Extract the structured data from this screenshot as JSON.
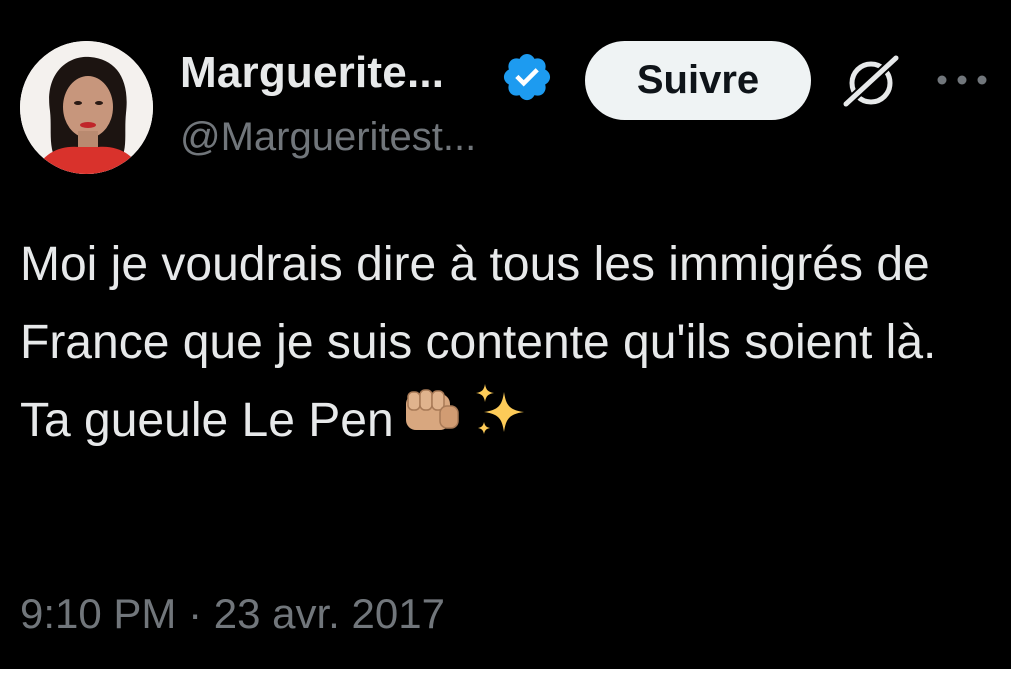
{
  "tweet": {
    "author": {
      "display_name": "Marguerite...",
      "handle": "@Margueritest...",
      "verified_icon": "verified-badge-icon",
      "avatar_icon": "profile-photo"
    },
    "actions": {
      "follow_label": "Suivre",
      "grok_icon": "grok-icon",
      "more_icon": "more-options-icon"
    },
    "text": "Moi je voudrais dire à tous les immigrés de France que je suis contente qu'ils soient là. Ta gueule Le Pen",
    "emojis": [
      "fist-emoji",
      "sparkles-emoji"
    ],
    "timestamp": "9:10 PM · 23 avr. 2017"
  },
  "colors": {
    "background": "#000000",
    "primary_text": "#e7e9ea",
    "secondary_text": "#71767b",
    "verified_blue": "#1d9bf0",
    "button_bg": "#eff3f4"
  }
}
